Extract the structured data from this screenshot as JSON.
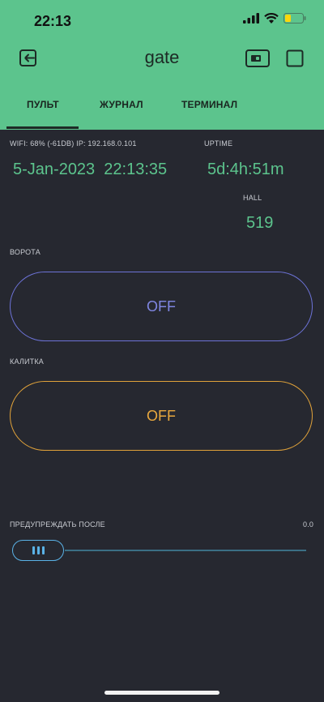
{
  "status": {
    "time": "22:13"
  },
  "header": {
    "title": "gate"
  },
  "tabs": [
    {
      "label": "ПУЛЬТ"
    },
    {
      "label": "ЖУРНАЛ"
    },
    {
      "label": "ТЕРМИНАЛ"
    }
  ],
  "info": {
    "wifi_label": "WIFI: 68% (-61DB) IP: 192.168.0.101",
    "datetime": "5-Jan-2023  22:13:35",
    "uptime_label": "UPTIME",
    "uptime_value": "5d:4h:51m",
    "hall_label": "HALL",
    "hall_value": "519"
  },
  "gate": {
    "label": "ВОРОТА",
    "state": "OFF"
  },
  "wicket": {
    "label": "КАЛИТКА",
    "state": "OFF"
  },
  "warning": {
    "label": "ПРЕДУПРЕЖДАТЬ ПОСЛЕ",
    "value": "0.0",
    "level": 0
  },
  "colors": {
    "header": "#5cc48d",
    "background": "#262830",
    "gate": "#6d73d8",
    "wicket": "#e0a23a",
    "slider": "#5ab2e6"
  }
}
